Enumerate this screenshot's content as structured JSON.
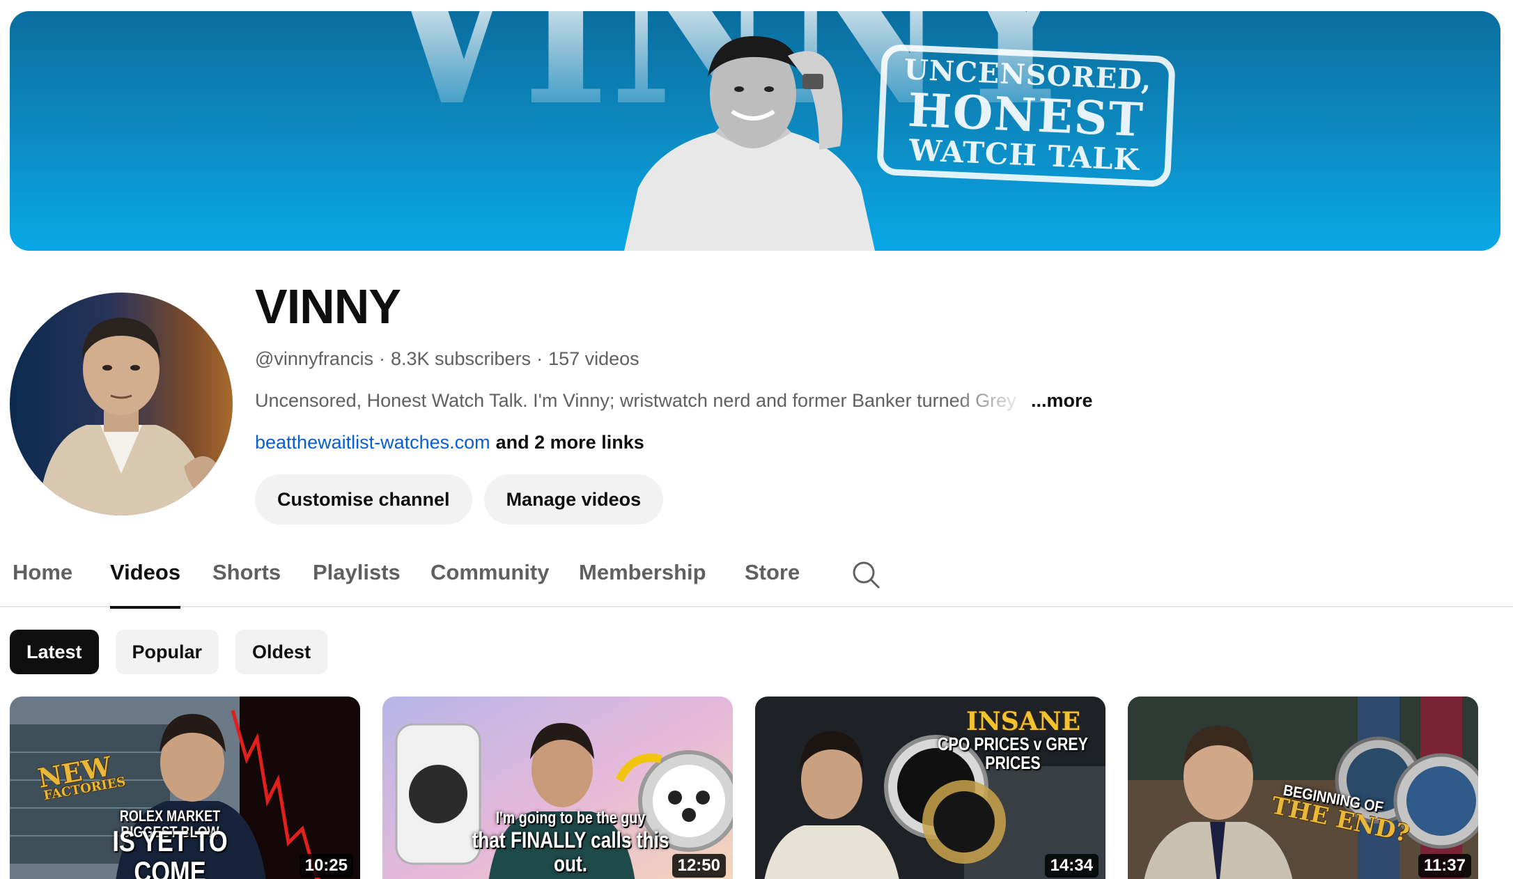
{
  "banner": {
    "big_text": "VINNY",
    "stamp_line1": "UNCENSORED,",
    "stamp_line2": "HONEST",
    "stamp_line3": "WATCH TALK"
  },
  "channel": {
    "name": "VINNY",
    "handle": "@vinnyfrancis",
    "subscribers": "8.3K subscribers",
    "videos": "157 videos",
    "description": "Uncensored, Honest Watch Talk. I'm Vinny; wristwatch nerd and former Banker turned Grey",
    "description_more": "...more",
    "link": "beatthewaitlist-watches.com",
    "more_links": "and 2 more links",
    "customise_button": "Customise channel",
    "manage_button": "Manage videos"
  },
  "tabs": [
    {
      "label": "Home",
      "active": false
    },
    {
      "label": "Videos",
      "active": true
    },
    {
      "label": "Shorts",
      "active": false
    },
    {
      "label": "Playlists",
      "active": false
    },
    {
      "label": "Community",
      "active": false
    },
    {
      "label": "Membership",
      "active": false
    },
    {
      "label": "Store",
      "active": false
    }
  ],
  "chips": [
    {
      "label": "Latest",
      "active": true
    },
    {
      "label": "Popular",
      "active": false
    },
    {
      "label": "Oldest",
      "active": false
    }
  ],
  "videos": [
    {
      "duration": "10:25",
      "badge_line1": "NEW",
      "badge_line2": "FACTORIES",
      "caption_line1": "ROLEX MARKET BIGGEST BLOW",
      "caption_line2": "IS YET TO COME"
    },
    {
      "duration": "12:50",
      "caption_line1": "I'm going to be the guy",
      "caption_line2": "that FINALLY calls this out."
    },
    {
      "duration": "14:34",
      "caption_line1": "INSANE",
      "caption_line2": "CPO PRICES v GREY PRICES"
    },
    {
      "duration": "11:37",
      "caption_line1": "BEGINNING OF",
      "caption_line2": "THE END?"
    }
  ]
}
